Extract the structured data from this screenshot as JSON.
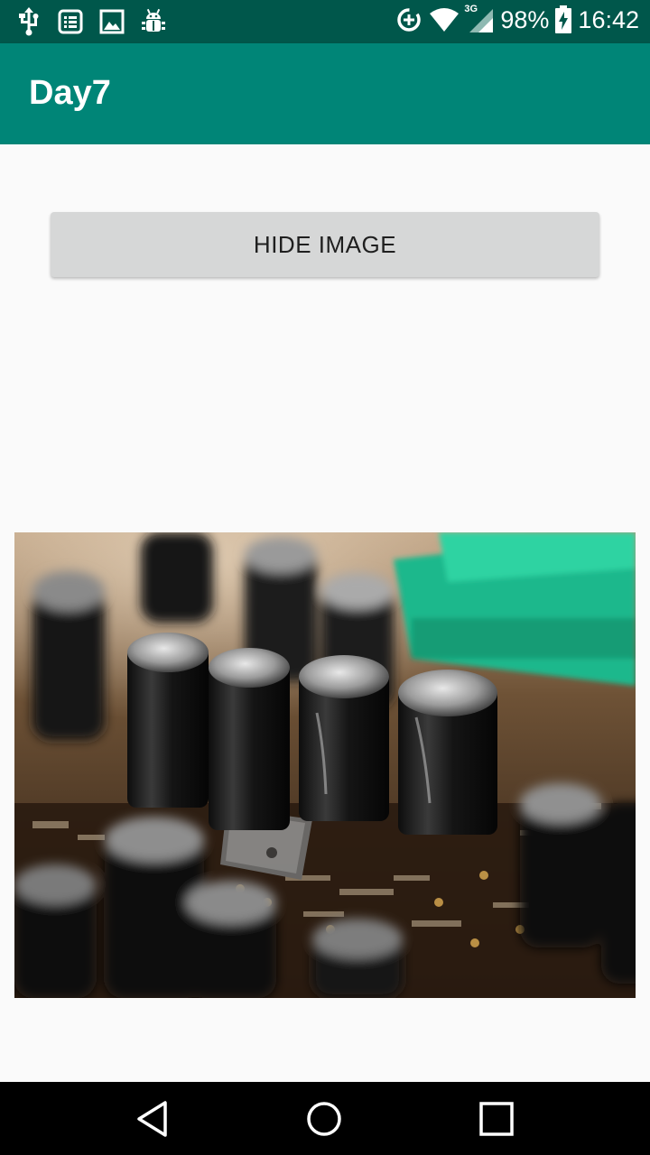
{
  "status_bar": {
    "left_icons": [
      "usb-icon",
      "notes-icon",
      "image-icon",
      "android-debug-icon"
    ],
    "right_icons": [
      "data-saver-icon",
      "wifi-icon",
      "signal-3g-icon",
      "battery-charging-icon"
    ],
    "network_type": "3G",
    "battery": "98%",
    "time": "16:42"
  },
  "app_bar": {
    "title": "Day7"
  },
  "main": {
    "hide_button_label": "HIDE IMAGE",
    "image": {
      "subject": "circuit board with capacitors"
    }
  },
  "nav_bar": {
    "buttons": [
      "back-icon",
      "home-icon",
      "recents-icon"
    ]
  },
  "colors": {
    "status_bar": "#00574b",
    "app_bar": "#008577",
    "button": "#d6d7d7",
    "background": "#fafafa"
  }
}
